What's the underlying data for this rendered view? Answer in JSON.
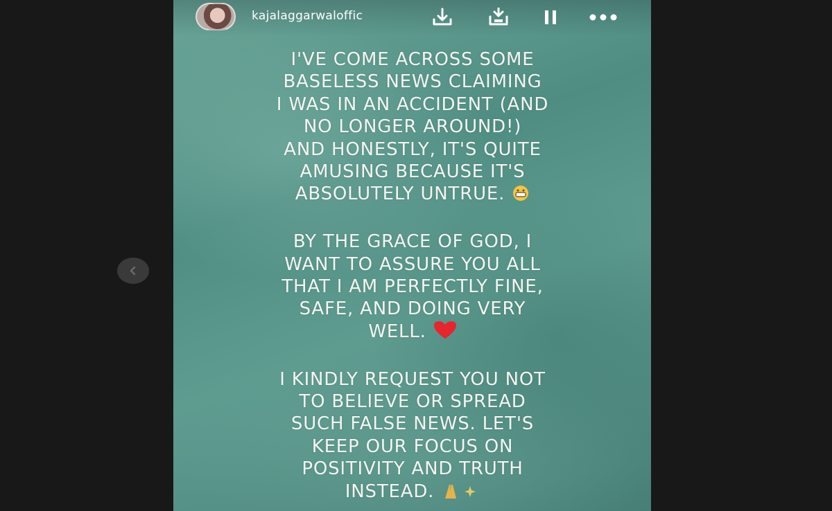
{
  "story": {
    "username": "kajalaggarwaloffic",
    "icons": {
      "download": "download-icon",
      "save": "save-icon",
      "pause": "pause-icon",
      "more": "more-options-icon",
      "previous": "chevron-left-icon"
    },
    "paragraphs": [
      {
        "lines": [
          "I'VE COME ACROSS SOME",
          "BASELESS NEWS CLAIMING",
          "I WAS IN AN ACCIDENT (AND",
          "NO LONGER AROUND!)",
          "AND HONESTLY, IT'S QUITE",
          "AMUSING BECAUSE IT'S",
          "ABSOLUTELY UNTRUE."
        ],
        "emoji": "grinning-face-emoji"
      },
      {
        "lines": [
          "BY THE GRACE OF GOD, I",
          "WANT TO ASSURE YOU ALL",
          "THAT I AM PERFECTLY FINE,",
          "SAFE, AND DOING VERY",
          "WELL."
        ],
        "emoji": "red-heart-emoji"
      },
      {
        "lines": [
          "I KINDLY REQUEST YOU NOT",
          "TO BELIEVE OR SPREAD",
          "SUCH FALSE NEWS. LET'S",
          "KEEP OUR FOCUS ON",
          "POSITIVITY AND TRUTH",
          "INSTEAD."
        ],
        "emoji": "folded-hands-sparkles-emoji"
      }
    ]
  }
}
